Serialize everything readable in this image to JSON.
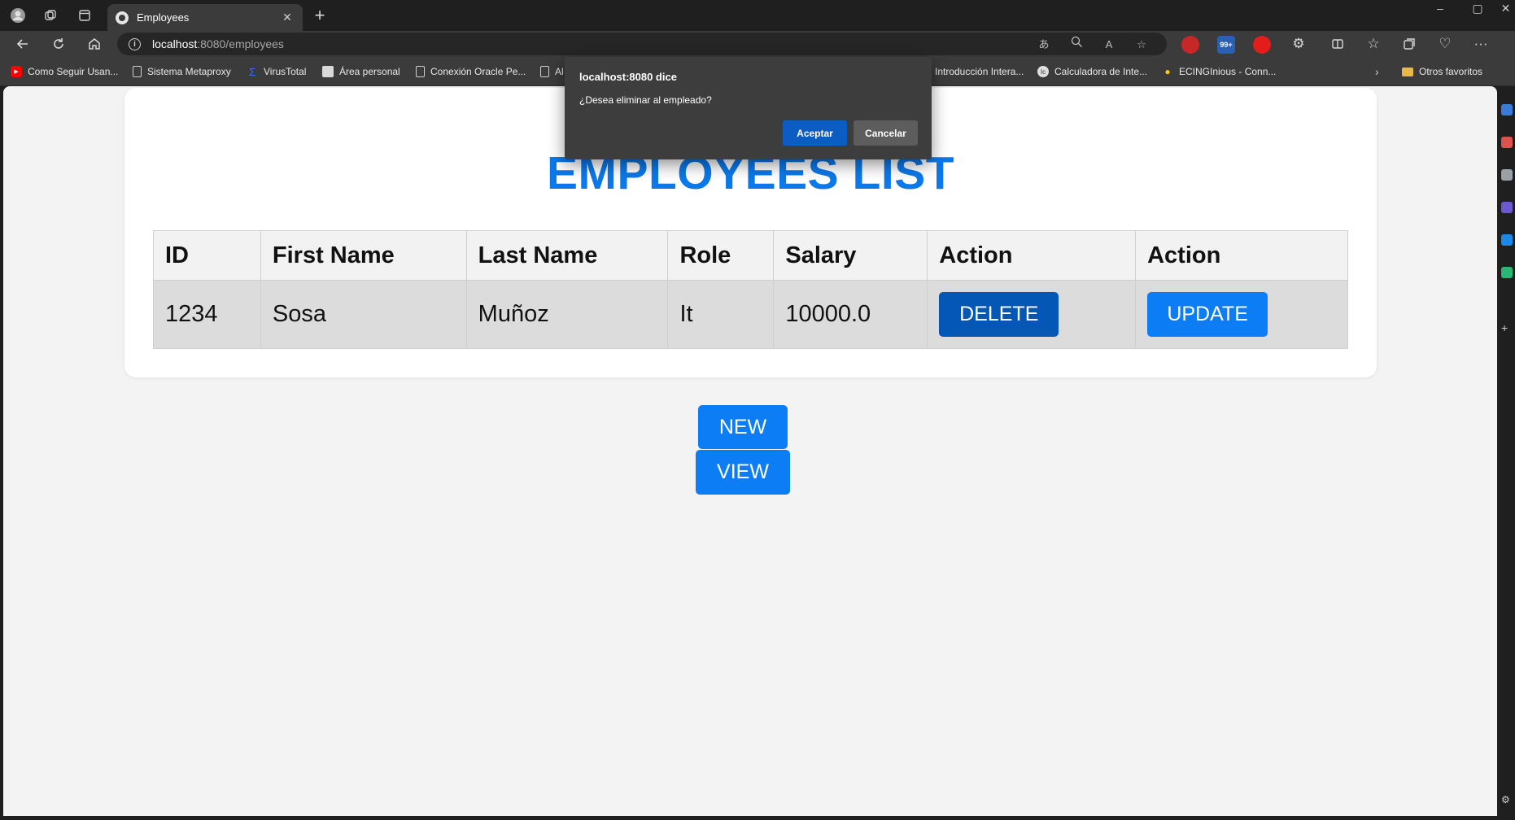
{
  "browser": {
    "tab": {
      "title": "Employees",
      "close": "✕"
    },
    "new_tab": "+",
    "window_controls": [
      "–",
      "▢",
      "✕"
    ],
    "url": {
      "host": "localhost",
      "rest": ":8080/employees"
    },
    "bookmarks": [
      {
        "label": "Como Seguir Usan...",
        "icon": "youtube-icon"
      },
      {
        "label": "Sistema Metaproxy",
        "icon": "document-icon"
      },
      {
        "label": "VirusTotal",
        "icon": "virustotal-icon"
      },
      {
        "label": "Área personal",
        "icon": "moodle-icon"
      },
      {
        "label": "Conexión Oracle Pe...",
        "icon": "document-icon"
      },
      {
        "label": "Al",
        "icon": "document-icon"
      },
      {
        "label": "Introducción Intera...",
        "icon": "globe-icon"
      },
      {
        "label": "Calculadora de Inte...",
        "icon": "calculator-icon"
      },
      {
        "label": "ECINGInious - Conn...",
        "icon": "bulb-icon"
      }
    ],
    "other_favorites": "Otros favoritos",
    "extension_badge": "99+"
  },
  "page": {
    "title": "EMPLOYEES LIST",
    "columns": [
      "ID",
      "First Name",
      "Last Name",
      "Role",
      "Salary",
      "Action",
      "Action"
    ],
    "rows": [
      {
        "id": "1234",
        "first_name": "Sosa",
        "last_name": "Muñoz",
        "role": "It",
        "salary": "10000.0"
      }
    ],
    "delete_label": "DELETE",
    "update_label": "UPDATE",
    "new_label": "NEW",
    "view_label": "VIEW",
    "colors": {
      "title": "#0b79ea",
      "delete": "#0557b6",
      "primary": "#0d7df5"
    }
  },
  "dialog": {
    "title": "localhost:8080 dice",
    "message": "¿Desea eliminar al empleado?",
    "accept": "Aceptar",
    "cancel": "Cancelar"
  }
}
